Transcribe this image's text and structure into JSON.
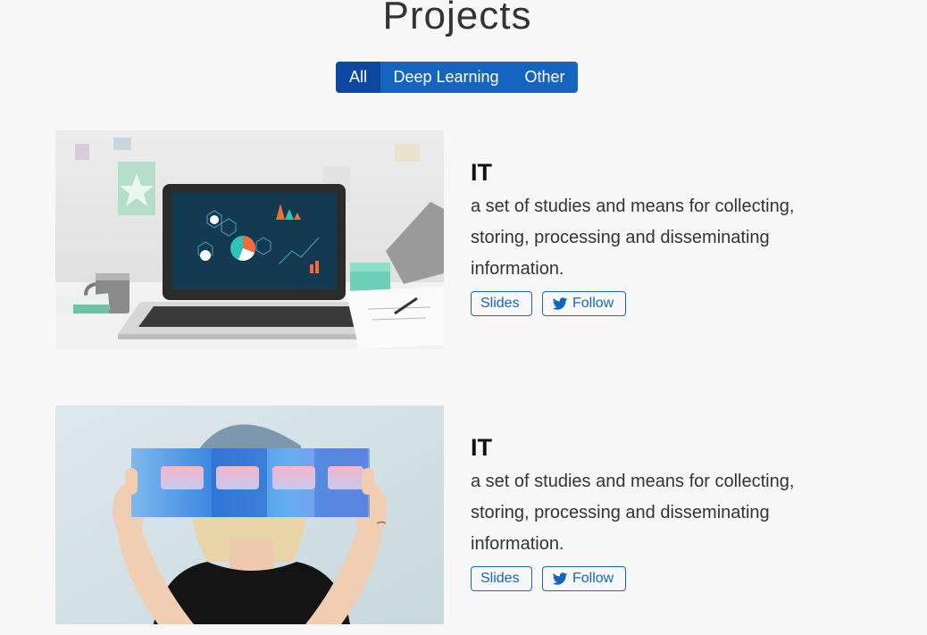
{
  "page": {
    "title": "Projects"
  },
  "filters": [
    {
      "label": "All",
      "active": true
    },
    {
      "label": "Deep Learning",
      "active": false
    },
    {
      "label": "Other",
      "active": false
    }
  ],
  "projects": [
    {
      "title": "IT",
      "description": "a set of studies and means for collecting, storing, processing and disseminating information.",
      "slides_label": "Slides",
      "follow_label": "Follow",
      "image": "laptop-desk-photo"
    },
    {
      "title": "IT",
      "description": "a set of studies and means for collecting, storing, processing and disseminating information.",
      "slides_label": "Slides",
      "follow_label": "Follow",
      "image": "person-holding-glasses-print-photo"
    }
  ],
  "colors": {
    "accent": "#1565c0",
    "accent_dark": "#0d47a1",
    "background": "#f7f7f7"
  },
  "icons": {
    "follow": "twitter-icon"
  }
}
